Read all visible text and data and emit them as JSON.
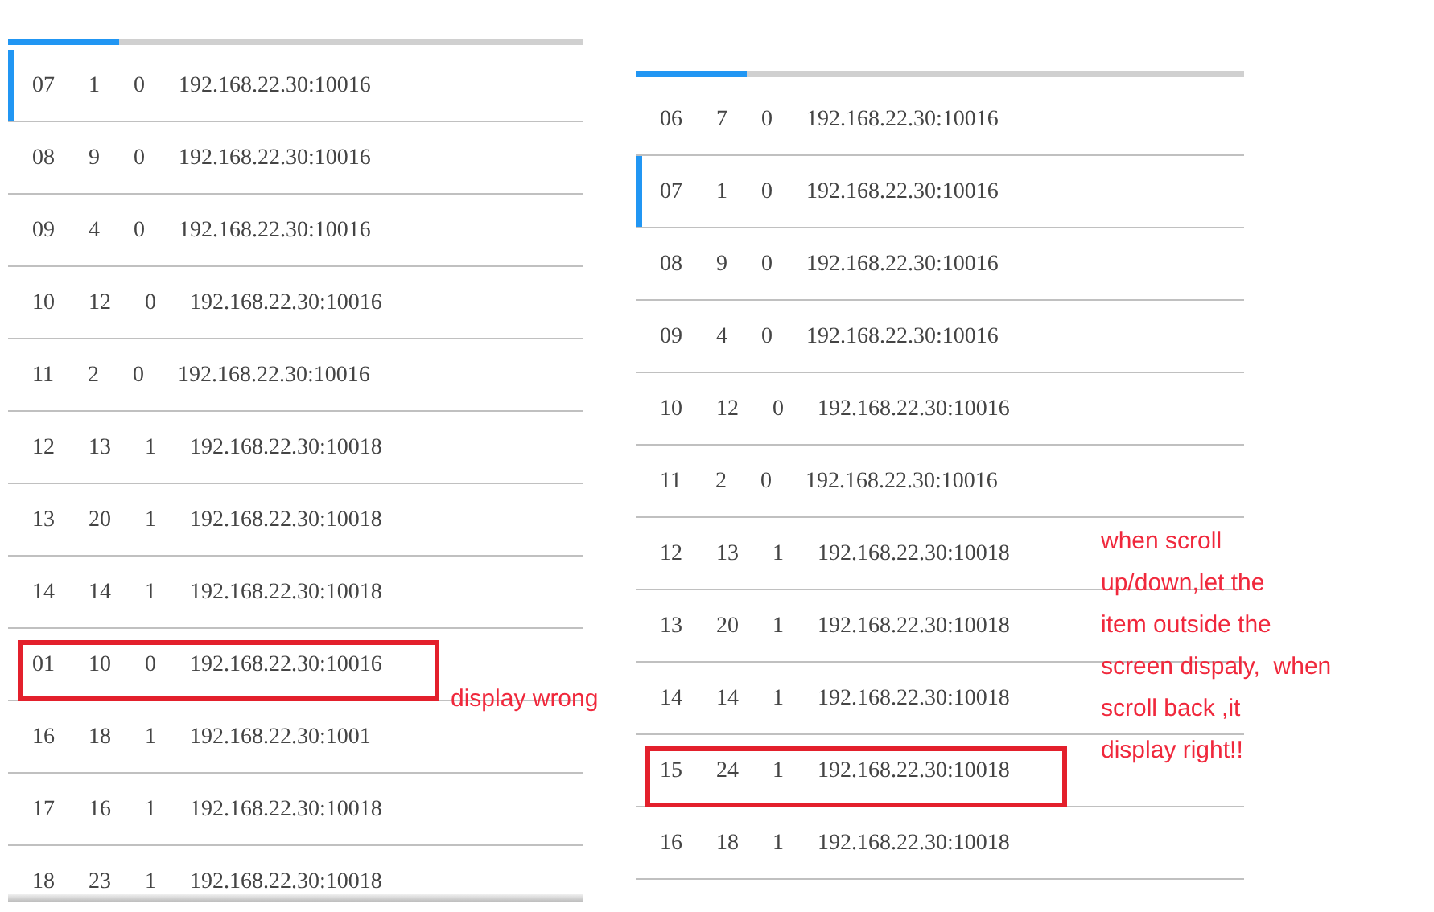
{
  "panels": [
    {
      "rows": [
        {
          "cells": [
            "07",
            "1",
            "0",
            "192.168.22.30:10016"
          ],
          "selected": true,
          "highlighted": false
        },
        {
          "cells": [
            "08",
            "9",
            "0",
            "192.168.22.30:10016"
          ],
          "selected": false,
          "highlighted": false
        },
        {
          "cells": [
            "09",
            "4",
            "0",
            "192.168.22.30:10016"
          ],
          "selected": false,
          "highlighted": false
        },
        {
          "cells": [
            "10",
            "12",
            "0",
            "192.168.22.30:10016"
          ],
          "selected": false,
          "highlighted": false
        },
        {
          "cells": [
            "11",
            "2",
            "0",
            "192.168.22.30:10016"
          ],
          "selected": false,
          "highlighted": false
        },
        {
          "cells": [
            "12",
            "13",
            "1",
            "192.168.22.30:10018"
          ],
          "selected": false,
          "highlighted": false
        },
        {
          "cells": [
            "13",
            "20",
            "1",
            "192.168.22.30:10018"
          ],
          "selected": false,
          "highlighted": false
        },
        {
          "cells": [
            "14",
            "14",
            "1",
            "192.168.22.30:10018"
          ],
          "selected": false,
          "highlighted": false
        },
        {
          "cells": [
            "01",
            "10",
            "0",
            "192.168.22.30:10016"
          ],
          "selected": false,
          "highlighted": true
        },
        {
          "cells": [
            "16",
            "18",
            "1",
            "192.168.22.30:1001"
          ],
          "selected": false,
          "highlighted": false
        },
        {
          "cells": [
            "17",
            "16",
            "1",
            "192.168.22.30:10018"
          ],
          "selected": false,
          "highlighted": false
        },
        {
          "cells": [
            "18",
            "23",
            "1",
            "192.168.22.30:10018"
          ],
          "selected": false,
          "highlighted": false
        }
      ],
      "annotation": [
        "display wrong"
      ]
    },
    {
      "rows": [
        {
          "cells": [
            "06",
            "7",
            "0",
            "192.168.22.30:10016"
          ],
          "selected": false,
          "highlighted": false
        },
        {
          "cells": [
            "07",
            "1",
            "0",
            "192.168.22.30:10016"
          ],
          "selected": true,
          "highlighted": false
        },
        {
          "cells": [
            "08",
            "9",
            "0",
            "192.168.22.30:10016"
          ],
          "selected": false,
          "highlighted": false
        },
        {
          "cells": [
            "09",
            "4",
            "0",
            "192.168.22.30:10016"
          ],
          "selected": false,
          "highlighted": false
        },
        {
          "cells": [
            "10",
            "12",
            "0",
            "192.168.22.30:10016"
          ],
          "selected": false,
          "highlighted": false
        },
        {
          "cells": [
            "11",
            "2",
            "0",
            "192.168.22.30:10016"
          ],
          "selected": false,
          "highlighted": false
        },
        {
          "cells": [
            "12",
            "13",
            "1",
            "192.168.22.30:10018"
          ],
          "selected": false,
          "highlighted": false
        },
        {
          "cells": [
            "13",
            "20",
            "1",
            "192.168.22.30:10018"
          ],
          "selected": false,
          "highlighted": false
        },
        {
          "cells": [
            "14",
            "14",
            "1",
            "192.168.22.30:10018"
          ],
          "selected": false,
          "highlighted": false
        },
        {
          "cells": [
            "15",
            "24",
            "1",
            "192.168.22.30:10018"
          ],
          "selected": false,
          "highlighted": true
        },
        {
          "cells": [
            "16",
            "18",
            "1",
            "192.168.22.30:10018"
          ],
          "selected": false,
          "highlighted": false
        }
      ],
      "annotation": [
        "when scroll",
        "up/down,let the",
        "item outside the",
        "screen dispaly,  when",
        "scroll back ,it",
        "display right!!"
      ]
    }
  ]
}
